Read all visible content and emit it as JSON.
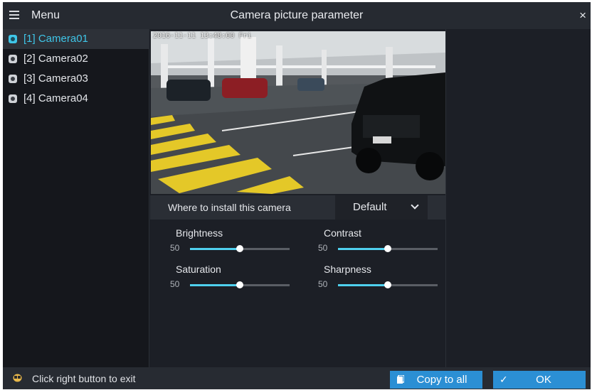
{
  "header": {
    "menu_label": "Menu",
    "title": "Camera picture parameter",
    "close_symbol": "×"
  },
  "cameras": [
    {
      "label": "[1] Camera01",
      "active": true
    },
    {
      "label": "[2] Camera02",
      "active": false
    },
    {
      "label": "[3] Camera03",
      "active": false
    },
    {
      "label": "[4] Camera04",
      "active": false
    }
  ],
  "preview": {
    "osd_timestamp": "2016-11-11  13:48:00 Fri"
  },
  "install": {
    "label": "Where to install this camera",
    "selected": "Default"
  },
  "params": [
    {
      "name": "Brightness",
      "value": "50",
      "level": 0.5
    },
    {
      "name": "Contrast",
      "value": "50",
      "level": 0.5
    },
    {
      "name": "Saturation",
      "value": "50",
      "level": 0.5
    },
    {
      "name": "Sharpness",
      "value": "50",
      "level": 0.5
    }
  ],
  "footer": {
    "exit_text": "Click right button to exit",
    "copy_label": "Copy to all",
    "ok_label": "OK"
  },
  "colors": {
    "accent": "#3fc6e8",
    "button": "#2b8fd4",
    "slider_fill": "#4fd0ee"
  },
  "icons": {
    "menu": "hamburger-icon",
    "close": "close-icon",
    "camera": "camera-icon",
    "dropdown": "chevron-down-icon",
    "exit": "mouse-icon",
    "copy": "copy-icon",
    "ok": "check-icon"
  }
}
